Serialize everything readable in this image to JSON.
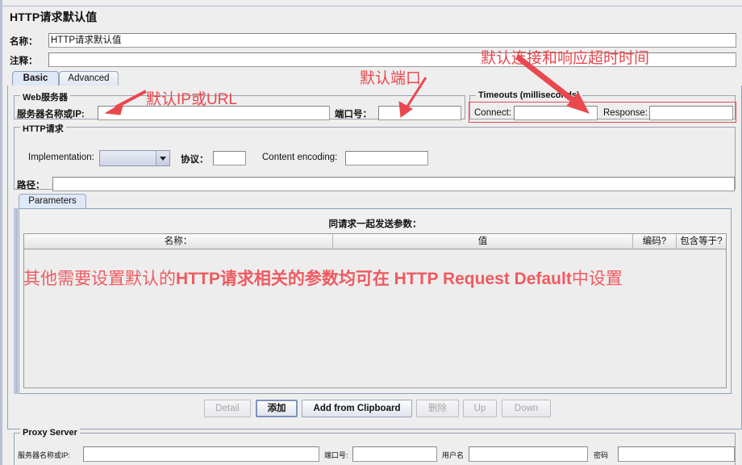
{
  "window": {
    "title": "HTTP请求默认值"
  },
  "header": {
    "name_label": "名称：",
    "name_value": "HTTP请求默认值",
    "comment_label": "注释：",
    "comment_value": ""
  },
  "tabs": [
    {
      "label": "Basic",
      "active": true
    },
    {
      "label": "Advanced",
      "active": false
    }
  ],
  "web_server": {
    "legend": "Web服务器",
    "server_label": "服务器名称或IP:",
    "server_value": "",
    "port_label": "端口号：",
    "port_value": ""
  },
  "timeouts": {
    "legend": "Timeouts (milliseconds)",
    "connect_label": "Connect:",
    "connect_value": "",
    "response_label": "Response:",
    "response_value": ""
  },
  "http_request": {
    "legend": "HTTP请求",
    "implementation_label": "Implementation:",
    "implementation_value": "",
    "protocol_label": "协议：",
    "protocol_value": "",
    "content_encoding_label": "Content encoding:",
    "content_encoding_value": "",
    "path_label": "路径：",
    "path_value": ""
  },
  "parameters": {
    "tab_label": "Parameters",
    "caption": "同请求一起发送参数：",
    "columns": [
      "名称：",
      "值",
      "编码?",
      "包含等于?"
    ],
    "rows": []
  },
  "buttons": [
    {
      "label": "Detail",
      "state": "disabled"
    },
    {
      "label": "添加",
      "state": "focused"
    },
    {
      "label": "Add from Clipboard",
      "state": "normal"
    },
    {
      "label": "删除",
      "state": "disabled"
    },
    {
      "label": "Up",
      "state": "disabled"
    },
    {
      "label": "Down",
      "state": "disabled"
    }
  ],
  "proxy_server": {
    "legend": "Proxy Server",
    "server_label": "服务器名称或IP:",
    "server_value": "",
    "port_label": "端口号:",
    "port_value": "",
    "username_label": "用户名",
    "username_value": "",
    "password_label": "密码",
    "password_value": ""
  },
  "annotations": {
    "ip_or_url": "默认IP或URL",
    "default_port": "默认端口",
    "timeout_note": "默认连接和响应超时时间",
    "body_note_1": "其他需要设置默认的",
    "body_note_2": "HTTP请求相关的参数均可在 ",
    "body_note_3": "HTTP Request Default",
    "body_note_4": "中设置"
  },
  "colors": {
    "annotation_red": "#e8484e",
    "note_red": "#ef5a60",
    "panel_bg": "#eeeeee",
    "tab_active": "#dfe8f6"
  }
}
